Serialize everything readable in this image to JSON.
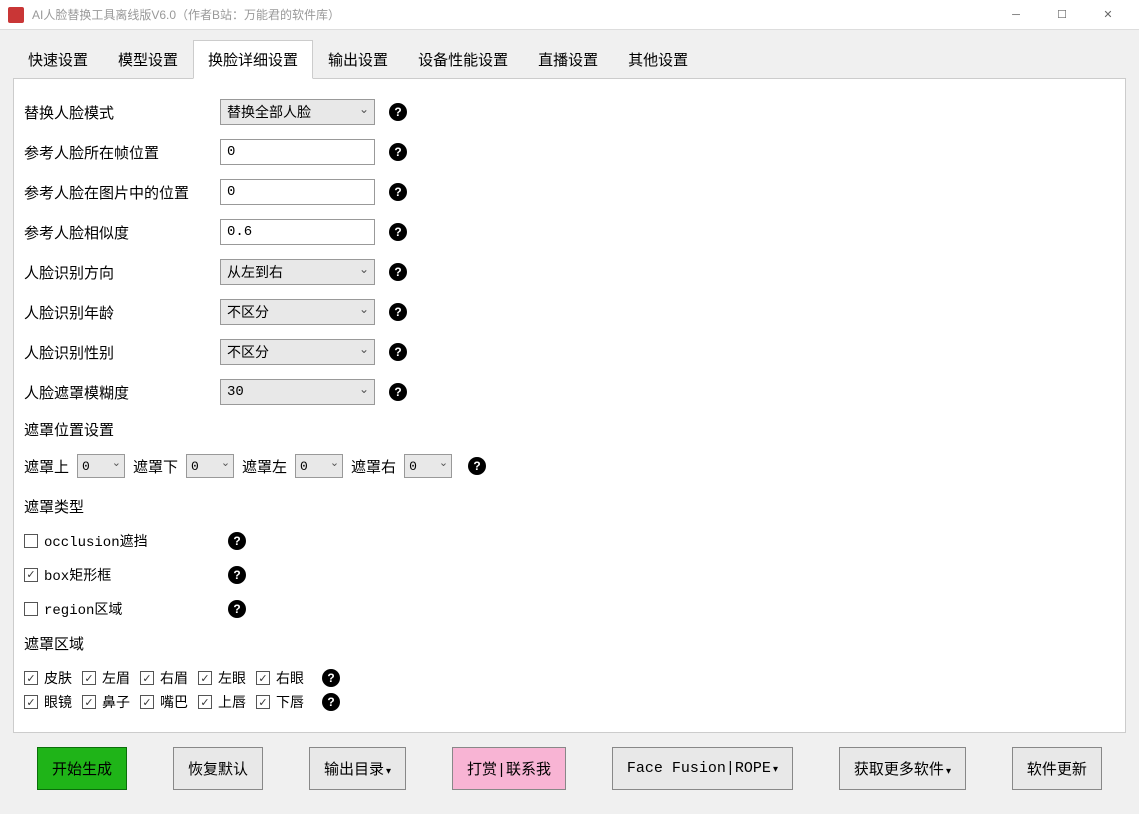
{
  "titlebar": {
    "title": "AI人脸替换工具离线版V6.0（作者B站：万能君的软件库）"
  },
  "tabs": [
    "快速设置",
    "模型设置",
    "换脸详细设置",
    "输出设置",
    "设备性能设置",
    "直播设置",
    "其他设置"
  ],
  "activeTab": 2,
  "form": {
    "faceMode": {
      "label": "替换人脸模式",
      "value": "替换全部人脸"
    },
    "refFrame": {
      "label": "参考人脸所在帧位置",
      "value": "0"
    },
    "refPos": {
      "label": "参考人脸在图片中的位置",
      "value": "0"
    },
    "similarity": {
      "label": "参考人脸相似度",
      "value": "0.6"
    },
    "direction": {
      "label": "人脸识别方向",
      "value": "从左到右"
    },
    "age": {
      "label": "人脸识别年龄",
      "value": "不区分"
    },
    "gender": {
      "label": "人脸识别性别",
      "value": "不区分"
    },
    "blur": {
      "label": "人脸遮罩模糊度",
      "value": "30"
    }
  },
  "maskPosition": {
    "title": "遮罩位置设置",
    "top": {
      "label": "遮罩上",
      "value": "0"
    },
    "bottom": {
      "label": "遮罩下",
      "value": "0"
    },
    "left": {
      "label": "遮罩左",
      "value": "0"
    },
    "right": {
      "label": "遮罩右",
      "value": "0"
    }
  },
  "maskType": {
    "title": "遮罩类型",
    "occlusion": {
      "label": "occlusion遮挡",
      "checked": false
    },
    "box": {
      "label": "box矩形框",
      "checked": true
    },
    "region": {
      "label": "region区域",
      "checked": false
    }
  },
  "maskRegion": {
    "title": "遮罩区域",
    "row1": [
      "皮肤",
      "左眉",
      "右眉",
      "左眼",
      "右眼"
    ],
    "row2": [
      "眼镜",
      "鼻子",
      "嘴巴",
      "上唇",
      "下唇"
    ]
  },
  "buttons": {
    "start": "开始生成",
    "restore": "恢复默认",
    "output": "输出目录",
    "donate": "打赏|联系我",
    "fusion": "Face Fusion|ROPE",
    "more": "获取更多软件",
    "update": "软件更新"
  }
}
